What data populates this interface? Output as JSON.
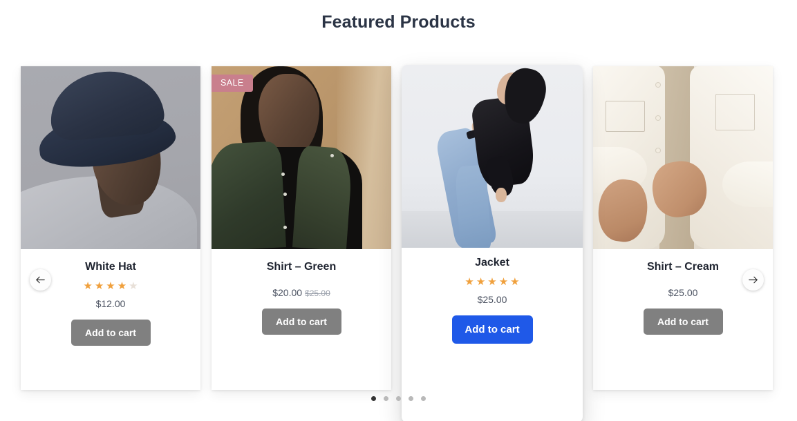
{
  "section": {
    "title": "Featured Products"
  },
  "products": [
    {
      "name": "White Hat",
      "price": "$12.00",
      "old_price": "",
      "rating": 4,
      "rating_max": 5,
      "show_rating": true,
      "badge": "",
      "add_label": "Add to cart",
      "highlighted": false
    },
    {
      "name": "Shirt – Green",
      "price": "$20.00",
      "old_price": "$25.00",
      "rating": 0,
      "rating_max": 5,
      "show_rating": false,
      "badge": "SALE",
      "add_label": "Add to cart",
      "highlighted": false
    },
    {
      "name": "Jacket",
      "price": "$25.00",
      "old_price": "",
      "rating": 5,
      "rating_max": 5,
      "show_rating": true,
      "badge": "",
      "add_label": "Add to cart",
      "highlighted": true
    },
    {
      "name": "Shirt – Cream",
      "price": "$25.00",
      "old_price": "",
      "rating": 0,
      "rating_max": 5,
      "show_rating": false,
      "badge": "",
      "add_label": "Add to cart",
      "highlighted": false
    }
  ],
  "carousel": {
    "prev_icon": "arrow-left-icon",
    "next_icon": "arrow-right-icon",
    "dot_count": 5,
    "active_dot": 1
  },
  "colors": {
    "accent_blue": "#1f59e8",
    "button_grey": "#808080",
    "star_on": "#f0a03c",
    "star_off": "#e8e0d8",
    "sale_badge": "#c97f8d",
    "title_text": "#2b3445",
    "dot_active": "#333333",
    "dot_inactive": "#b9b9b9"
  }
}
